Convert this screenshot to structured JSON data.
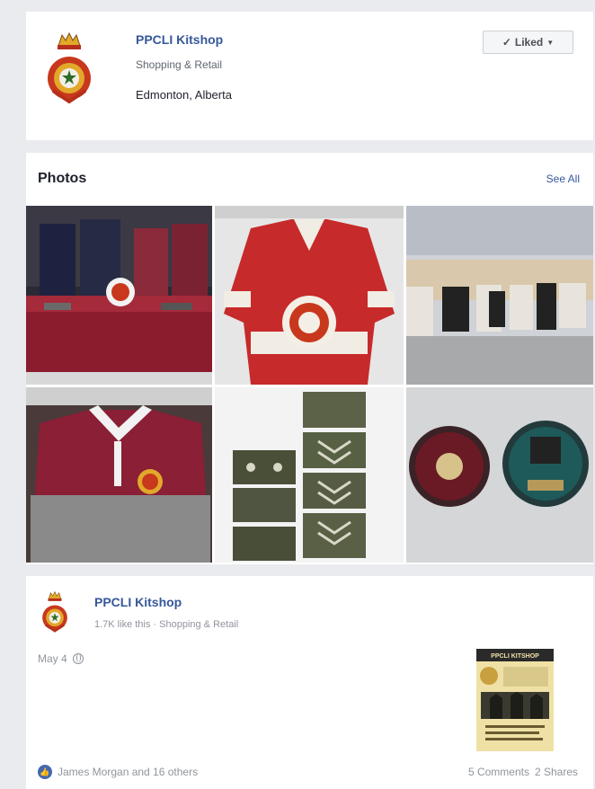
{
  "page": {
    "name": "PPCLI Kitshop",
    "category": "Shopping & Retail",
    "location": "Edmonton, Alberta",
    "liked_button": {
      "check_icon": "checkmark-icon",
      "label": "Liked",
      "chevron_icon": "chevron-down-icon"
    }
  },
  "photos": {
    "title": "Photos",
    "see_all": "See All",
    "items": [
      {
        "name": "photo-display-table"
      },
      {
        "name": "photo-red-hockey-jersey"
      },
      {
        "name": "photo-boxed-prints"
      },
      {
        "name": "photo-rugby-shirt"
      },
      {
        "name": "photo-rank-patches"
      },
      {
        "name": "photo-plaques"
      }
    ]
  },
  "post": {
    "page_name": "PPCLI Kitshop",
    "meta": "1.7K like this · Shopping & Retail",
    "date": "May 4",
    "poster_text": "PPCLI KITSHOP",
    "reactions_text": "James Morgan and 16 others",
    "comments": "5 Comments",
    "shares": "2 Shares"
  },
  "colors": {
    "link_blue": "#365899",
    "like_blue": "#4267b2",
    "background": "#e9ebee",
    "crest_red": "#c8381d",
    "crest_gold": "#e2a82a"
  }
}
